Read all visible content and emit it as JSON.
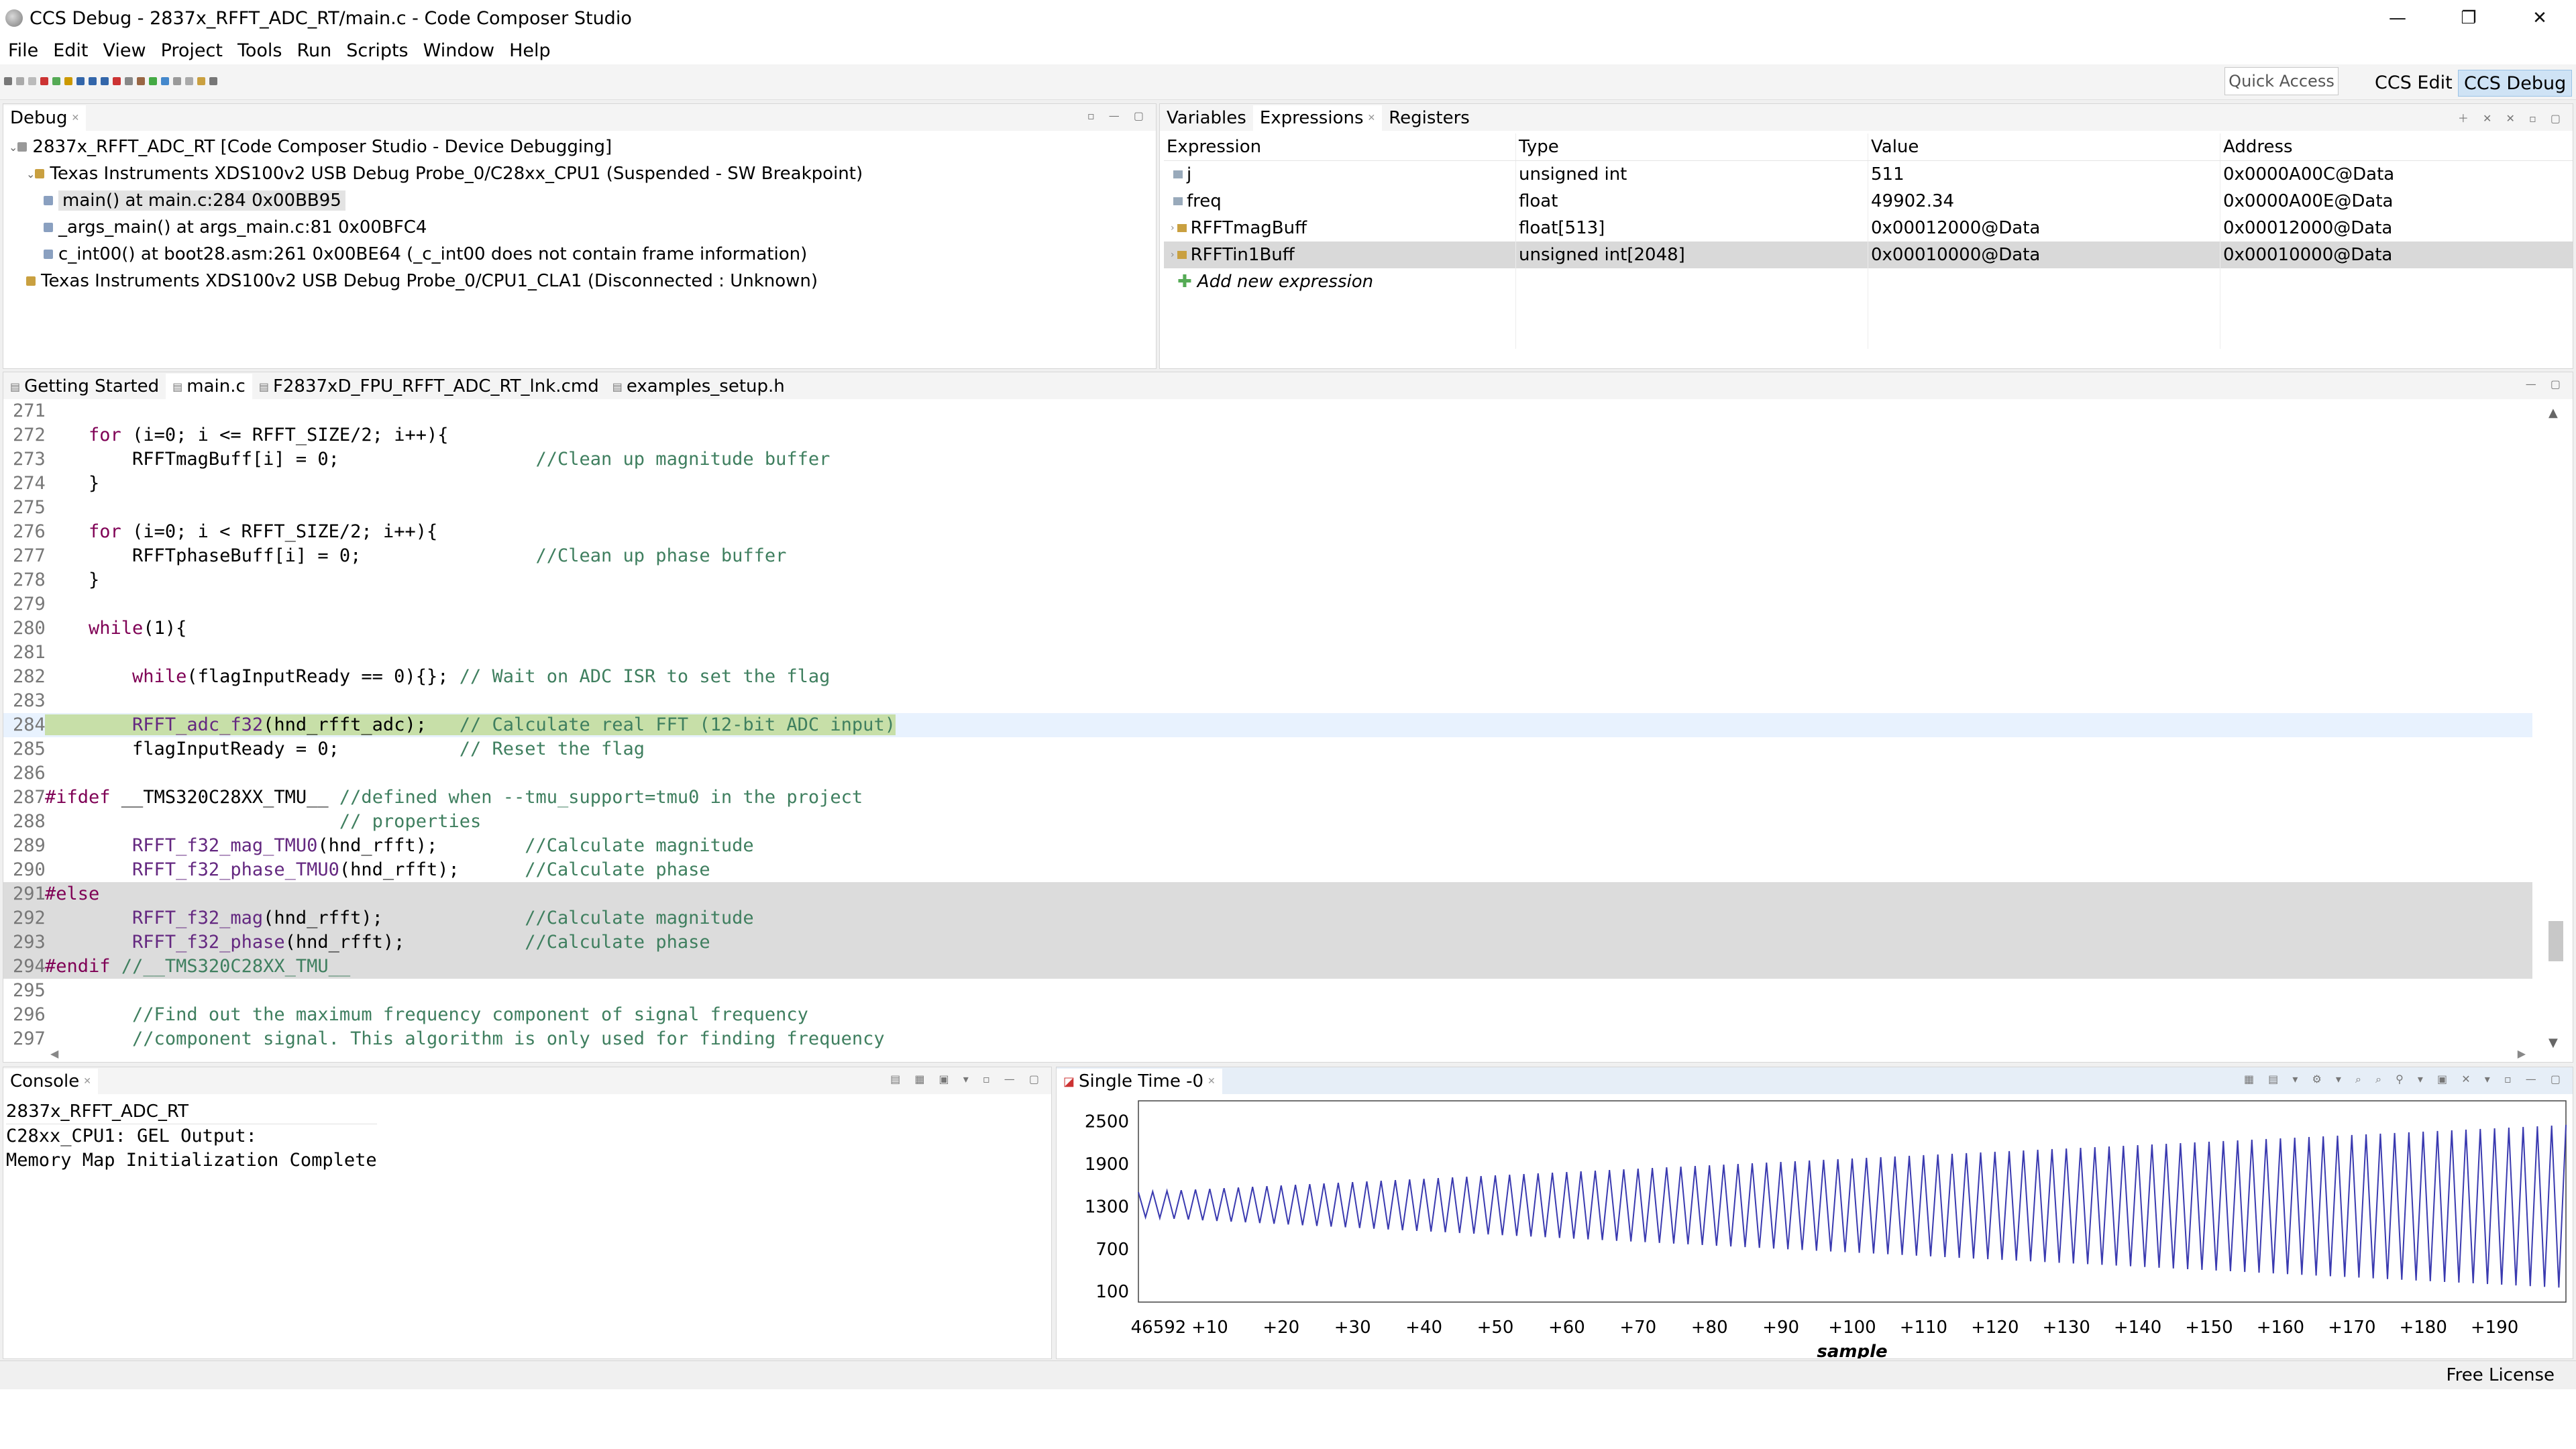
{
  "window": {
    "title": "CCS Debug - 2837x_RFFT_ADC_RT/main.c - Code Composer Studio",
    "minimize": "—",
    "restore": "❐",
    "close": "✕"
  },
  "menu": [
    "File",
    "Edit",
    "View",
    "Project",
    "Tools",
    "Run",
    "Scripts",
    "Window",
    "Help"
  ],
  "toolbar": {
    "quick_access": "Quick Access",
    "perspectives": [
      "CCS Edit",
      "CCS Debug"
    ],
    "active_perspective": "CCS Debug"
  },
  "debug_view": {
    "tab": "Debug",
    "items": [
      {
        "label": "2837x_RFFT_ADC_RT [Code Composer Studio - Device Debugging]",
        "indent": 0,
        "icon": "launch-icon"
      },
      {
        "label": "Texas Instruments XDS100v2 USB Debug Probe_0/C28xx_CPU1 (Suspended - SW Breakpoint)",
        "indent": 1,
        "icon": "thread-icon"
      },
      {
        "label": "main() at main.c:284 0x00BB95",
        "indent": 2,
        "icon": "stack-frame-icon",
        "selected": true
      },
      {
        "label": "_args_main() at args_main.c:81 0x00BFC4",
        "indent": 2,
        "icon": "stack-frame-icon"
      },
      {
        "label": "c_int00() at boot28.asm:261 0x00BE64  (_c_int00 does not contain frame information)",
        "indent": 2,
        "icon": "stack-frame-icon"
      },
      {
        "label": "Texas Instruments XDS100v2 USB Debug Probe_0/CPU1_CLA1 (Disconnected : Unknown)",
        "indent": 1,
        "icon": "thread-icon"
      }
    ]
  },
  "expressions_view": {
    "tabs": [
      "Variables",
      "Expressions",
      "Registers"
    ],
    "active_tab": "Expressions",
    "columns": [
      "Expression",
      "Type",
      "Value",
      "Address"
    ],
    "rows": [
      {
        "expression": "j",
        "type": "unsigned int",
        "value": "511",
        "address": "0x0000A00C@Data",
        "expandable": false
      },
      {
        "expression": "freq",
        "type": "float",
        "value": "49902.34",
        "address": "0x0000A00E@Data",
        "expandable": false
      },
      {
        "expression": "RFFTmagBuff",
        "type": "float[513]",
        "value": "0x00012000@Data",
        "address": "0x00012000@Data",
        "expandable": true
      },
      {
        "expression": "RFFTin1Buff",
        "type": "unsigned int[2048]",
        "value": "0x00010000@Data",
        "address": "0x00010000@Data",
        "expandable": true,
        "selected": true
      }
    ],
    "add_new": "Add new expression"
  },
  "editor": {
    "tabs": [
      "Getting Started",
      "main.c",
      "F2837xD_FPU_RFFT_ADC_RT_lnk.cmd",
      "examples_setup.h"
    ],
    "active_tab": "main.c",
    "lines": [
      {
        "n": "271",
        "code": ""
      },
      {
        "n": "272",
        "code": "    for (i=0; i <= RFFT_SIZE/2; i++){"
      },
      {
        "n": "273",
        "code": "        RFFTmagBuff[i] = 0;                  //Clean up magnitude buffer"
      },
      {
        "n": "274",
        "code": "    }"
      },
      {
        "n": "275",
        "code": ""
      },
      {
        "n": "276",
        "code": "    for (i=0; i < RFFT_SIZE/2; i++){"
      },
      {
        "n": "277",
        "code": "        RFFTphaseBuff[i] = 0;                //Clean up phase buffer"
      },
      {
        "n": "278",
        "code": "    }"
      },
      {
        "n": "279",
        "code": ""
      },
      {
        "n": "280",
        "code": "    while(1){"
      },
      {
        "n": "281",
        "code": ""
      },
      {
        "n": "282",
        "code": "        while(flagInputReady == 0){}; // Wait on ADC ISR to set the flag"
      },
      {
        "n": "283",
        "code": ""
      },
      {
        "n": "284",
        "code": "        RFFT_adc_f32(hnd_rfft_adc);   // Calculate real FFT (12-bit ADC input)",
        "current": true
      },
      {
        "n": "285",
        "code": "        flagInputReady = 0;           // Reset the flag"
      },
      {
        "n": "286",
        "code": ""
      },
      {
        "n": "287",
        "code": "#ifdef __TMS320C28XX_TMU__ //defined when --tmu_support=tmu0 in the project"
      },
      {
        "n": "288",
        "code": "                           // properties"
      },
      {
        "n": "289",
        "code": "        RFFT_f32_mag_TMU0(hnd_rfft);        //Calculate magnitude"
      },
      {
        "n": "290",
        "code": "        RFFT_f32_phase_TMU0(hnd_rfft);      //Calculate phase"
      },
      {
        "n": "291",
        "code": "#else",
        "inactive": true
      },
      {
        "n": "292",
        "code": "        RFFT_f32_mag(hnd_rfft);             //Calculate magnitude",
        "inactive": true
      },
      {
        "n": "293",
        "code": "        RFFT_f32_phase(hnd_rfft);           //Calculate phase",
        "inactive": true
      },
      {
        "n": "294",
        "code": "#endif //__TMS320C28XX_TMU__",
        "inactive": true
      },
      {
        "n": "295",
        "code": ""
      },
      {
        "n": "296",
        "code": "        //Find out the maximum frequency component of signal frequency"
      },
      {
        "n": "297",
        "code": "        //component signal. This algorithm is only used for finding frequency"
      }
    ]
  },
  "console": {
    "tab": "Console",
    "project": "2837x_RFFT_ADC_RT",
    "lines": [
      "C28xx_CPU1: GEL Output:",
      "Memory Map Initialization Complete"
    ]
  },
  "graph": {
    "tab": "Single Time -0",
    "line_color": "#3a3ab0"
  },
  "chart_data": {
    "type": "line",
    "xlabel": "sample",
    "ylabel": "",
    "x_ticks": [
      "46592",
      "+10",
      "+20",
      "+30",
      "+40",
      "+50",
      "+60",
      "+70",
      "+80",
      "+90",
      "+100",
      "+110",
      "+120",
      "+130",
      "+140",
      "+150",
      "+160",
      "+170",
      "+180",
      "+190"
    ],
    "y_ticks": [
      2500,
      1900,
      1300,
      700,
      100
    ],
    "xlim": [
      0,
      200
    ],
    "ylim": [
      -50,
      2600
    ],
    "series": [
      {
        "description": "chirp-like triangular waveform with increasing amplitude",
        "samples": 200,
        "start_low": 1150,
        "start_high": 1500,
        "end_low": 150,
        "end_high": 2450
      }
    ]
  },
  "status_bar": {
    "license": "Free License"
  }
}
